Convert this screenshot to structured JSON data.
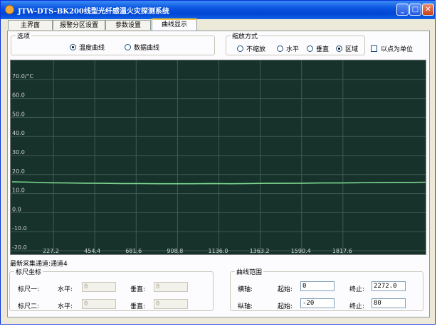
{
  "window": {
    "title": "JTW-DTS-BK200线型光纤感温火灾探测系统",
    "minimize": "_",
    "maximize": "□",
    "close": "✕"
  },
  "tabs": [
    {
      "label": "主界面",
      "active": false
    },
    {
      "label": "报警分区设置",
      "active": false
    },
    {
      "label": "参数设置",
      "active": false
    },
    {
      "label": "曲线显示",
      "active": true
    }
  ],
  "options": {
    "title": "选项",
    "temp_curve": "温度曲线",
    "data_curve": "数据曲线",
    "selected": "temp_curve"
  },
  "zoom": {
    "title": "缩放方式",
    "items": [
      "不缩放",
      "水平",
      "垂直",
      "区域"
    ],
    "selected": "区域",
    "point_unit": "以点为单位",
    "point_unit_checked": false
  },
  "chart_data": {
    "type": "line",
    "ylim": [
      -20,
      80
    ],
    "xlim": [
      0,
      2272
    ],
    "y_ticks": [
      "70.0/°C",
      "60.0",
      "50.0",
      "40.0",
      "30.0",
      "20.0",
      "10.0",
      "0.0",
      "-10.0",
      "-20.0"
    ],
    "y_tick_values": [
      70,
      60,
      50,
      40,
      30,
      20,
      10,
      0,
      -10,
      -20
    ],
    "x_ticks": [
      "227.2",
      "454.4",
      "681.6",
      "908.8",
      "1136.0",
      "1363.2",
      "1590.4",
      "1817.6"
    ],
    "x_tick_values": [
      227.2,
      454.4,
      681.6,
      908.8,
      1136.0,
      1363.2,
      1590.4,
      1817.6
    ],
    "grid": true,
    "series": [
      {
        "color": "#7dd98f",
        "x": [
          0,
          100,
          200,
          300,
          400,
          500,
          600,
          700,
          800,
          900,
          1000,
          1100,
          1200,
          1300,
          1400,
          1500,
          1600,
          1700,
          1800,
          1900,
          2000,
          2100,
          2200,
          2272
        ],
        "y": [
          16.2,
          16.0,
          15.7,
          15.6,
          15.5,
          15.4,
          15.3,
          15.3,
          15.2,
          15.2,
          15.2,
          15.3,
          15.2,
          15.3,
          15.4,
          15.4,
          15.5,
          15.6,
          15.6,
          15.7,
          15.8,
          15.9,
          15.9,
          16.0
        ]
      }
    ],
    "colors": {
      "background": "#16322b",
      "grid": "#3e5b53",
      "tick": "#cfd6d2"
    }
  },
  "status": {
    "latest_channel": "最新采集通道:通道4"
  },
  "ruler": {
    "title": "标尺坐标",
    "ruler1": "标尺一:",
    "ruler2": "标尺二:",
    "horizontal": "水平:",
    "vertical": "垂直:",
    "r1_h": "0",
    "r1_v": "0",
    "r2_h": "0",
    "r2_v": "0"
  },
  "range": {
    "title": "曲线范围",
    "x_axis": "横轴:",
    "y_axis": "纵轴:",
    "start": "起始:",
    "end": "终止:",
    "x_start": "0",
    "x_end": "2272.0",
    "y_start": "-20",
    "y_end": "80"
  }
}
